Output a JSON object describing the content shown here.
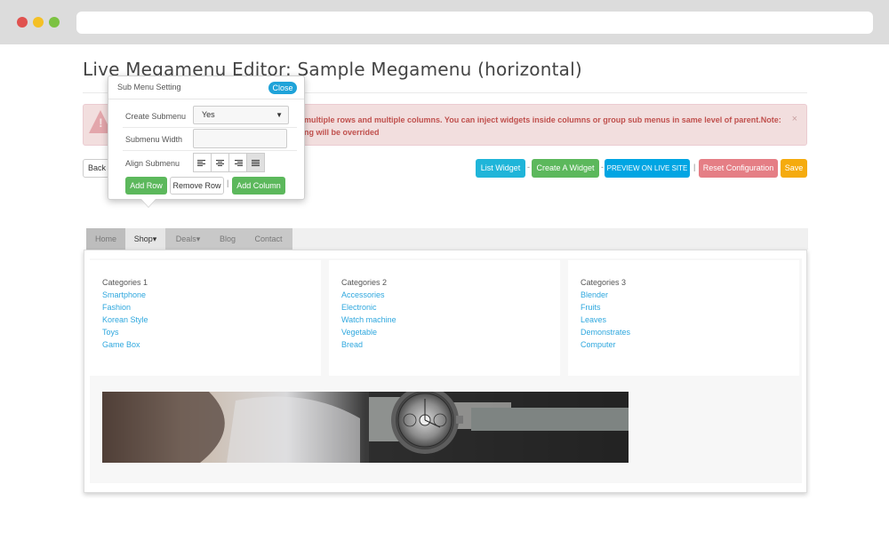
{
  "page": {
    "title": "Live Megamenu Editor: Sample Megamenu (horizontal)"
  },
  "alert": {
    "text_line1": "multiple rows and multiple columns. You can inject widgets inside columns or group sub menus in same level of parent.Note:",
    "text_line2": "ng will be overrided",
    "close": "×"
  },
  "toolbar": {
    "back": "Back",
    "list_widget": "List Widget",
    "sep1": "-",
    "create_widget": "Create A Widget",
    "sep2": "-",
    "preview": "PREVIEW ON LIVE SITE",
    "sep3": "|",
    "reset": "Reset Configuration",
    "save": "Save"
  },
  "submenu_popup": {
    "title": "Sub Menu Setting",
    "close": "Close",
    "create_submenu_label": "Create Submenu",
    "create_submenu_value": "Yes",
    "submenu_width_label": "Submenu Width",
    "submenu_width_value": "",
    "align_label": "Align Submenu",
    "align_options": [
      "left",
      "center",
      "right",
      "justify"
    ],
    "align_selected": "justify",
    "add_row": "Add Row",
    "remove_row": "Remove Row",
    "sep": "|",
    "add_column": "Add Column"
  },
  "menu": {
    "items": [
      {
        "label": "Home"
      },
      {
        "label": "Shop▾"
      },
      {
        "label": "Deals▾"
      },
      {
        "label": "Blog"
      },
      {
        "label": "Contact"
      }
    ],
    "active": "Shop"
  },
  "dropdown": {
    "columns": [
      {
        "title": "Categories 1",
        "links": [
          "Smartphone",
          "Fashion",
          "Korean Style",
          "Toys",
          "Game Box"
        ]
      },
      {
        "title": "Categories 2",
        "links": [
          "Accessories",
          "Electronic",
          "Watch machine",
          "Vegetable",
          "Bread"
        ]
      },
      {
        "title": "Categories 3",
        "links": [
          "Blender",
          "Fruits",
          "Leaves",
          "Demonstrates",
          "Computer"
        ]
      }
    ]
  },
  "colors": {
    "info_blue": "#1fb5d9",
    "success_green": "#5cb85c",
    "danger_pink": "#e57e85",
    "warning_orange": "#f5ab0e",
    "link_blue": "#2ea7de"
  }
}
